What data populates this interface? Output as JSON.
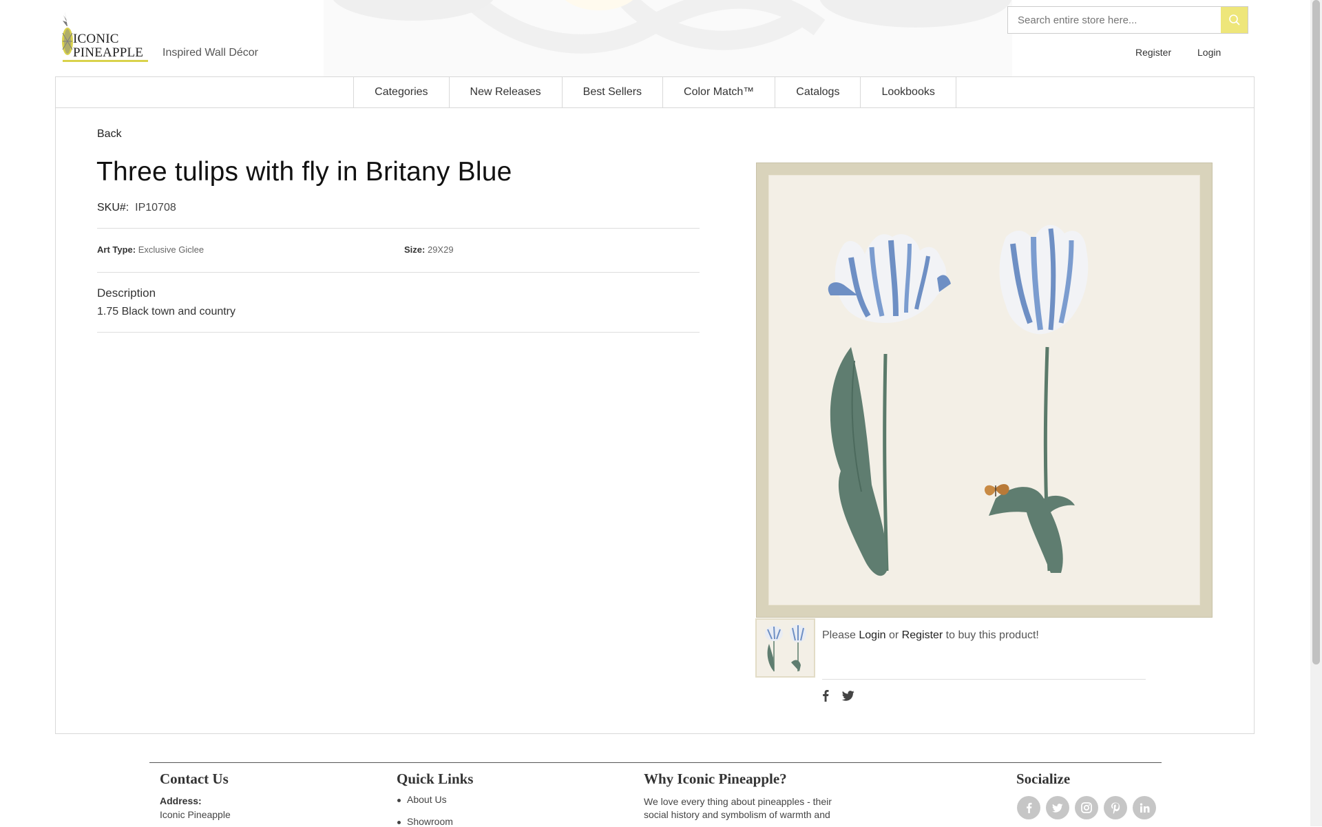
{
  "brand": {
    "logo_line1": "ICONIC",
    "logo_line2": "PINEAPPLE",
    "tagline": "Inspired Wall Décor",
    "accent_color": "#eee67a"
  },
  "search": {
    "placeholder": "Search entire store here..."
  },
  "account": {
    "register": "Register",
    "login": "Login"
  },
  "nav": [
    "Categories",
    "New Releases",
    "Best Sellers",
    "Color Match™",
    "Catalogs",
    "Lookbooks"
  ],
  "product": {
    "back": "Back",
    "title": "Three tulips with fly in Britany Blue",
    "sku_label": "SKU#:",
    "sku": "IP10708",
    "art_type_label": "Art Type:",
    "art_type": "Exclusive Giclee",
    "size_label": "Size:",
    "size": "29X29",
    "description_heading": "Description",
    "description": "1.75 Black town and country"
  },
  "purchase": {
    "prefix": "Please ",
    "login": "Login",
    "or": " or ",
    "register": "Register",
    "suffix": " to buy this product!"
  },
  "share": [
    "facebook-icon",
    "twitter-icon"
  ],
  "footer": {
    "contact": {
      "heading": "Contact Us",
      "address_label": "Address:",
      "address_line1": "Iconic Pineapple"
    },
    "quick_links": {
      "heading": "Quick Links",
      "items": [
        "About Us",
        "Showroom"
      ]
    },
    "why": {
      "heading": "Why Iconic Pineapple?",
      "line1": "We love every thing about pineapples - their",
      "line2": "social history and symbolism of warmth and"
    },
    "socialize": {
      "heading": "Socialize",
      "icons": [
        "facebook-icon",
        "twitter-icon",
        "instagram-icon",
        "pinterest-icon",
        "linkedin-icon"
      ]
    }
  }
}
